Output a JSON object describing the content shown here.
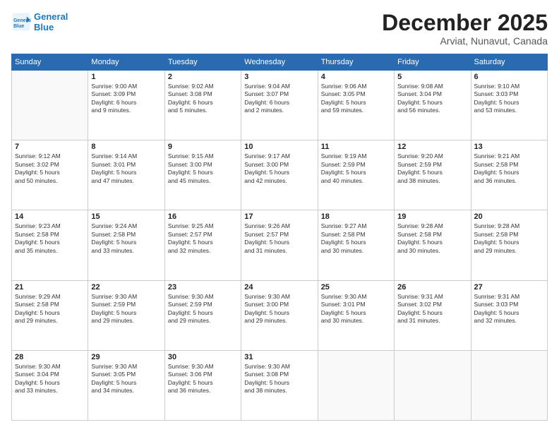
{
  "header": {
    "logo_line1": "General",
    "logo_line2": "Blue",
    "month": "December 2025",
    "location": "Arviat, Nunavut, Canada"
  },
  "days_of_week": [
    "Sunday",
    "Monday",
    "Tuesday",
    "Wednesday",
    "Thursday",
    "Friday",
    "Saturday"
  ],
  "weeks": [
    [
      {
        "num": "",
        "info": ""
      },
      {
        "num": "1",
        "info": "Sunrise: 9:00 AM\nSunset: 3:09 PM\nDaylight: 6 hours\nand 9 minutes."
      },
      {
        "num": "2",
        "info": "Sunrise: 9:02 AM\nSunset: 3:08 PM\nDaylight: 6 hours\nand 5 minutes."
      },
      {
        "num": "3",
        "info": "Sunrise: 9:04 AM\nSunset: 3:07 PM\nDaylight: 6 hours\nand 2 minutes."
      },
      {
        "num": "4",
        "info": "Sunrise: 9:06 AM\nSunset: 3:05 PM\nDaylight: 5 hours\nand 59 minutes."
      },
      {
        "num": "5",
        "info": "Sunrise: 9:08 AM\nSunset: 3:04 PM\nDaylight: 5 hours\nand 56 minutes."
      },
      {
        "num": "6",
        "info": "Sunrise: 9:10 AM\nSunset: 3:03 PM\nDaylight: 5 hours\nand 53 minutes."
      }
    ],
    [
      {
        "num": "7",
        "info": "Sunrise: 9:12 AM\nSunset: 3:02 PM\nDaylight: 5 hours\nand 50 minutes."
      },
      {
        "num": "8",
        "info": "Sunrise: 9:14 AM\nSunset: 3:01 PM\nDaylight: 5 hours\nand 47 minutes."
      },
      {
        "num": "9",
        "info": "Sunrise: 9:15 AM\nSunset: 3:00 PM\nDaylight: 5 hours\nand 45 minutes."
      },
      {
        "num": "10",
        "info": "Sunrise: 9:17 AM\nSunset: 3:00 PM\nDaylight: 5 hours\nand 42 minutes."
      },
      {
        "num": "11",
        "info": "Sunrise: 9:19 AM\nSunset: 2:59 PM\nDaylight: 5 hours\nand 40 minutes."
      },
      {
        "num": "12",
        "info": "Sunrise: 9:20 AM\nSunset: 2:59 PM\nDaylight: 5 hours\nand 38 minutes."
      },
      {
        "num": "13",
        "info": "Sunrise: 9:21 AM\nSunset: 2:58 PM\nDaylight: 5 hours\nand 36 minutes."
      }
    ],
    [
      {
        "num": "14",
        "info": "Sunrise: 9:23 AM\nSunset: 2:58 PM\nDaylight: 5 hours\nand 35 minutes."
      },
      {
        "num": "15",
        "info": "Sunrise: 9:24 AM\nSunset: 2:58 PM\nDaylight: 5 hours\nand 33 minutes."
      },
      {
        "num": "16",
        "info": "Sunrise: 9:25 AM\nSunset: 2:57 PM\nDaylight: 5 hours\nand 32 minutes."
      },
      {
        "num": "17",
        "info": "Sunrise: 9:26 AM\nSunset: 2:57 PM\nDaylight: 5 hours\nand 31 minutes."
      },
      {
        "num": "18",
        "info": "Sunrise: 9:27 AM\nSunset: 2:58 PM\nDaylight: 5 hours\nand 30 minutes."
      },
      {
        "num": "19",
        "info": "Sunrise: 9:28 AM\nSunset: 2:58 PM\nDaylight: 5 hours\nand 30 minutes."
      },
      {
        "num": "20",
        "info": "Sunrise: 9:28 AM\nSunset: 2:58 PM\nDaylight: 5 hours\nand 29 minutes."
      }
    ],
    [
      {
        "num": "21",
        "info": "Sunrise: 9:29 AM\nSunset: 2:58 PM\nDaylight: 5 hours\nand 29 minutes."
      },
      {
        "num": "22",
        "info": "Sunrise: 9:30 AM\nSunset: 2:59 PM\nDaylight: 5 hours\nand 29 minutes."
      },
      {
        "num": "23",
        "info": "Sunrise: 9:30 AM\nSunset: 2:59 PM\nDaylight: 5 hours\nand 29 minutes."
      },
      {
        "num": "24",
        "info": "Sunrise: 9:30 AM\nSunset: 3:00 PM\nDaylight: 5 hours\nand 29 minutes."
      },
      {
        "num": "25",
        "info": "Sunrise: 9:30 AM\nSunset: 3:01 PM\nDaylight: 5 hours\nand 30 minutes."
      },
      {
        "num": "26",
        "info": "Sunrise: 9:31 AM\nSunset: 3:02 PM\nDaylight: 5 hours\nand 31 minutes."
      },
      {
        "num": "27",
        "info": "Sunrise: 9:31 AM\nSunset: 3:03 PM\nDaylight: 5 hours\nand 32 minutes."
      }
    ],
    [
      {
        "num": "28",
        "info": "Sunrise: 9:30 AM\nSunset: 3:04 PM\nDaylight: 5 hours\nand 33 minutes."
      },
      {
        "num": "29",
        "info": "Sunrise: 9:30 AM\nSunset: 3:05 PM\nDaylight: 5 hours\nand 34 minutes."
      },
      {
        "num": "30",
        "info": "Sunrise: 9:30 AM\nSunset: 3:06 PM\nDaylight: 5 hours\nand 36 minutes."
      },
      {
        "num": "31",
        "info": "Sunrise: 9:30 AM\nSunset: 3:08 PM\nDaylight: 5 hours\nand 38 minutes."
      },
      {
        "num": "",
        "info": ""
      },
      {
        "num": "",
        "info": ""
      },
      {
        "num": "",
        "info": ""
      }
    ]
  ]
}
